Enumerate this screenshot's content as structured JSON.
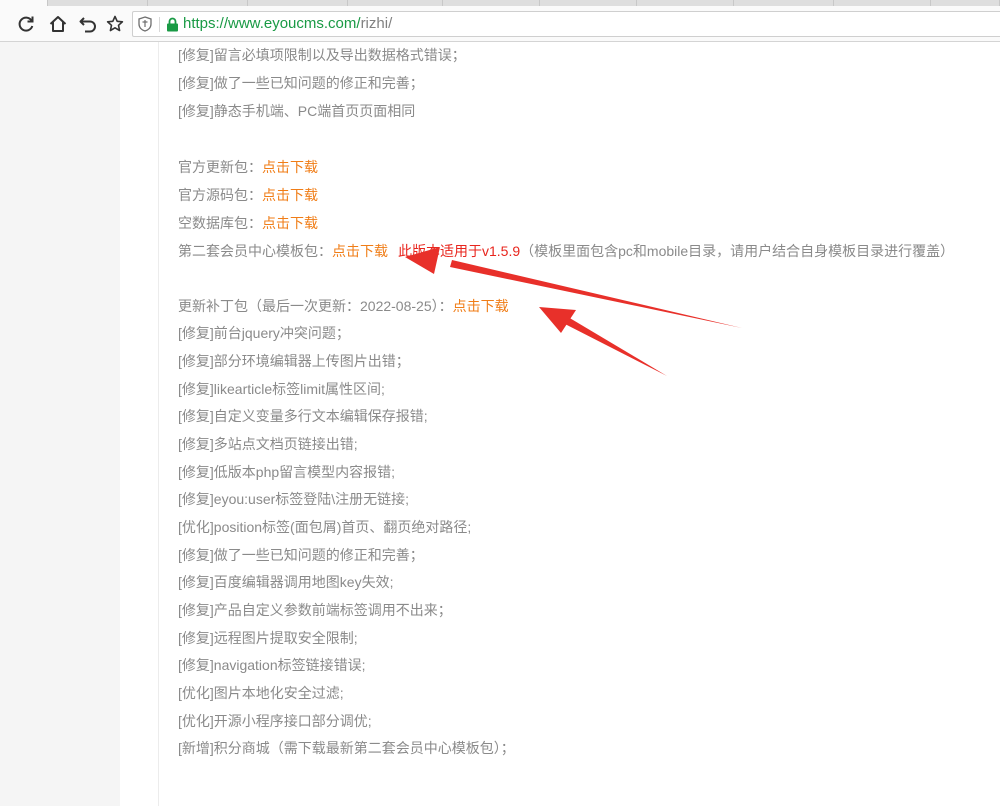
{
  "browser": {
    "url_host": "https://www.eyoucms.com/",
    "url_path": "rizhi/"
  },
  "article": {
    "top_fixes": [
      "[修复]留言必填项限制以及导出数据格式错误；",
      "[修复]做了一些已知问题的修正和完善；",
      "[修复]静态手机端、PC端首页页面相同"
    ],
    "downloads": [
      {
        "label": "官方更新包：",
        "link": "点击下载"
      },
      {
        "label": "官方源码包：",
        "link": "点击下载"
      },
      {
        "label": "空数据库包：",
        "link": "点击下载"
      }
    ],
    "member_template": {
      "label": "第二套会员中心模板包：",
      "link": "点击下载",
      "version_note": "此版本适用于v1.5.9",
      "note": "（模板里面包含pc和mobile目录，请用户结合自身模板目录进行覆盖）"
    },
    "patch": {
      "label": "更新补丁包（最后一次更新：2022-08-25）：",
      "link": "点击下载",
      "items": [
        "[修复]前台jquery冲突问题；",
        "[修复]部分环境编辑器上传图片出错；",
        "[修复]likearticle标签limit属性区间;",
        "[修复]自定义变量多行文本编辑保存报错;",
        "[修复]多站点文档页链接出错;",
        "[修复]低版本php留言模型内容报错;",
        "[修复]eyou:user标签登陆\\注册无链接;",
        "[优化]position标签(面包屑)首页、翻页绝对路径;",
        "[修复]做了一些已知问题的修正和完善；",
        "[修复]百度编辑器调用地图key失效;",
        "[修复]产品自定义参数前端标签调用不出来；",
        "[修复]远程图片提取安全限制;",
        "[修复]navigation标签链接错误;",
        "[优化]图片本地化安全过滤;",
        "[优化]开源小程序接口部分调优;",
        "[新增]积分商城（需下载最新第二套会员中心模板包）；"
      ]
    }
  },
  "colors": {
    "text": "#8a8a8a",
    "link": "#f07d17",
    "version_note": "#e8251d",
    "arrow": "#e8302a",
    "url_host": "#1a9a45"
  }
}
